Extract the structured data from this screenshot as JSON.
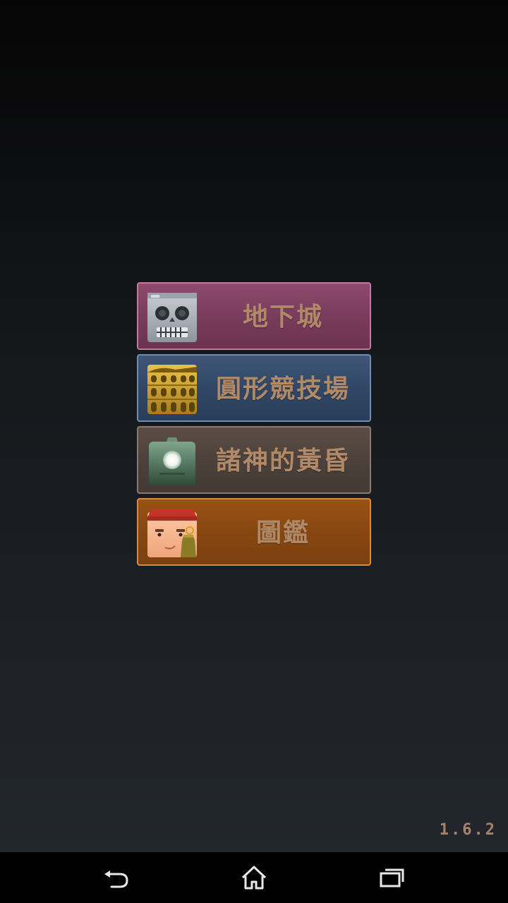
{
  "menu": {
    "items": [
      {
        "label": "地下城",
        "icon": "skull-icon",
        "color": "#7a3c5c"
      },
      {
        "label": "圓形競技場",
        "icon": "colosseum-icon",
        "color": "#314765"
      },
      {
        "label": "諸神的黃昏",
        "icon": "eye-monolith-icon",
        "color": "#4c413b"
      },
      {
        "label": "圖鑑",
        "icon": "merchant-face-icon",
        "color": "#884711"
      }
    ]
  },
  "version": "1.6.2",
  "navbar": {
    "back": "back-icon",
    "home": "home-icon",
    "recents": "recents-icon"
  }
}
